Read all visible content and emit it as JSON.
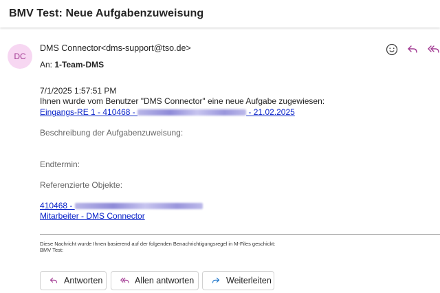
{
  "header": {
    "title": "BMV Test: Neue Aufgabenzuweisung"
  },
  "message": {
    "avatar_initials": "DC",
    "sender": "DMS Connector<dms-support@tso.de>",
    "to_label": "An:",
    "to_value": "1-Team-DMS",
    "icons": [
      "emoji-icon",
      "reply-icon",
      "reply-all-icon"
    ]
  },
  "content": {
    "timestamp": "7/1/2025 1:57:51 PM",
    "intro": "Ihnen wurde vom Benutzer \"DMS Connector\" eine neue Aufgabe zugewiesen:",
    "task_link_prefix": "Eingangs-RE 1 - 410468 - ",
    "task_link_suffix": " - 21.02.2025",
    "description_label": "Beschreibung der Aufgabenzuweisung:",
    "deadline_label": "Endtermin:",
    "referenced_label": "Referenzierte Objekte:",
    "ref_link_1_prefix": "410468 - ",
    "ref_link_2": "Mitarbeiter - DMS Connector",
    "footer_line_1": "Diese Nachricht wurde Ihnen basierend auf der folgenden Benachrichtigungsregel in M-Files geschickt:",
    "footer_line_2": "BMV Test:"
  },
  "buttons": {
    "reply": "Antworten",
    "reply_all": "Allen antworten",
    "forward": "Weiterleiten"
  },
  "colors": {
    "accent": "#a23a93",
    "link": "#0b24c9",
    "avatar_bg": "#f7d7f2"
  }
}
